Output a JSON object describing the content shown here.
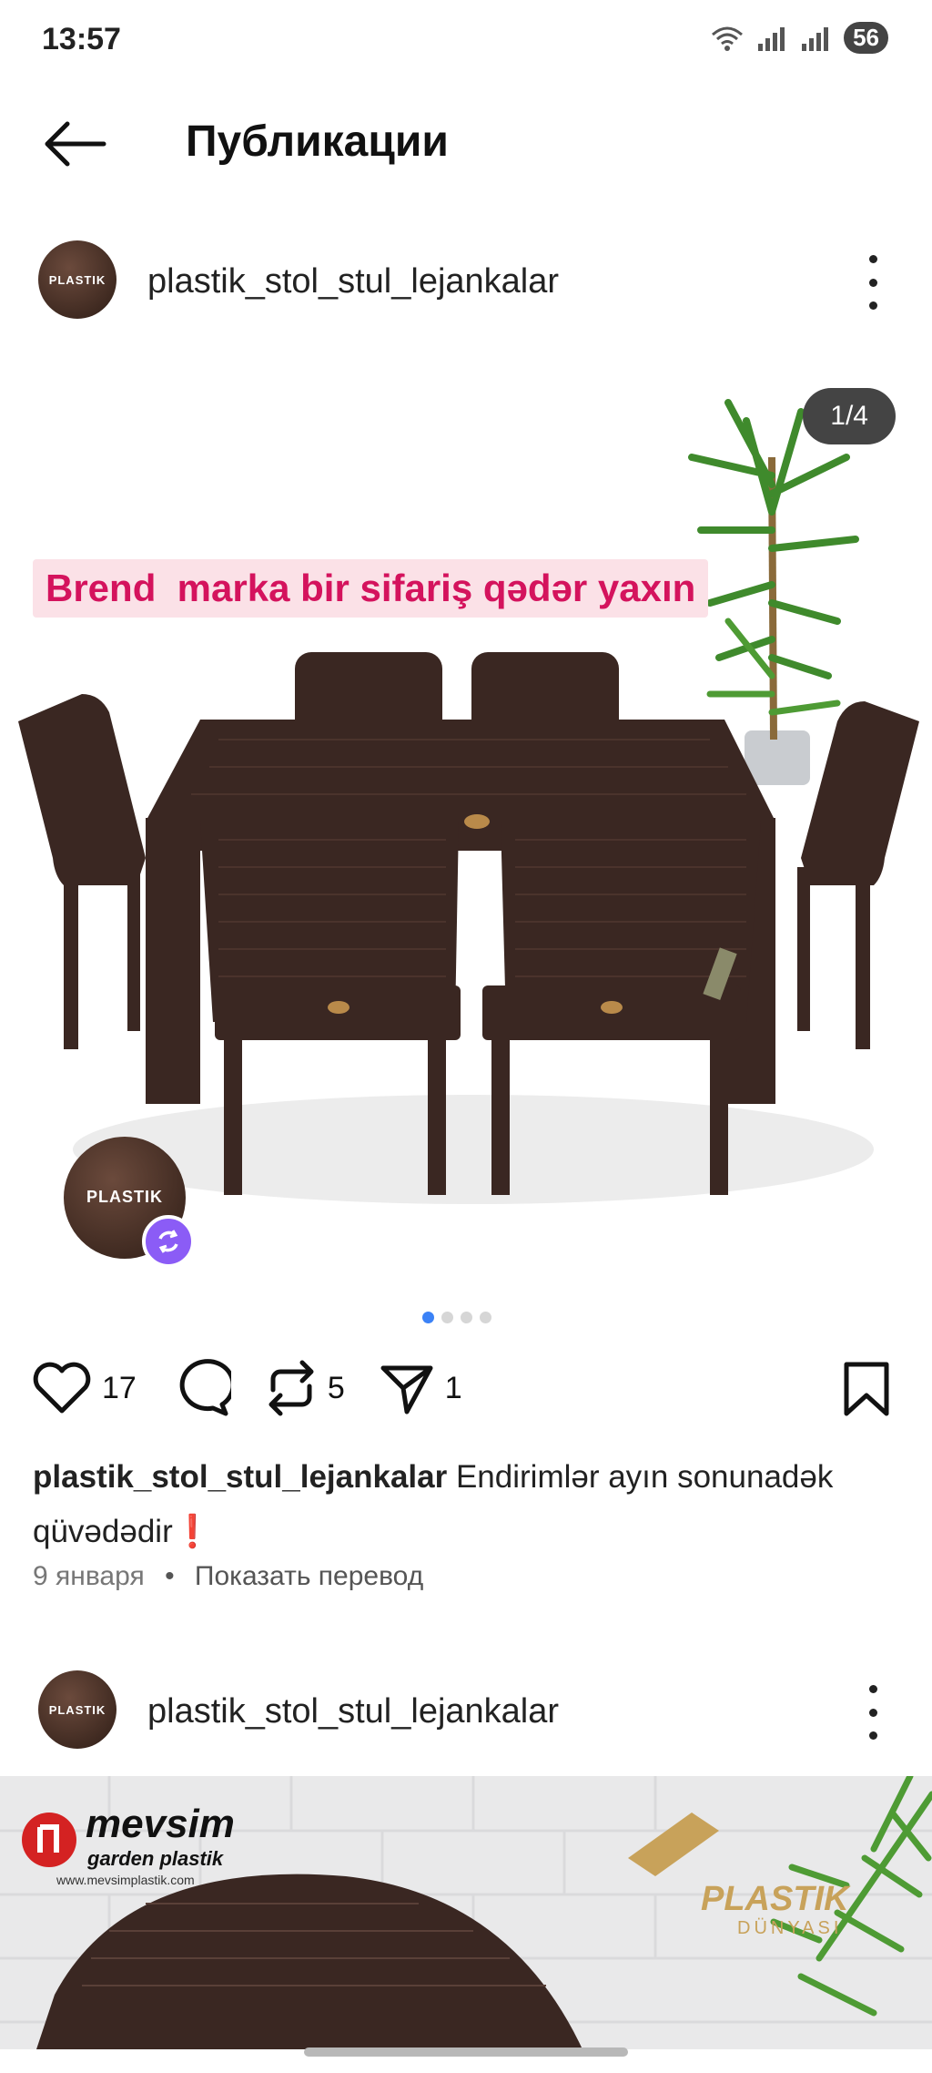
{
  "status_bar": {
    "time": "13:57",
    "battery": "56"
  },
  "header": {
    "title": "Публикации"
  },
  "post1": {
    "username": "plastik_stol_stul_lejankalar",
    "avatar_text": "PLASTIK",
    "media_counter": "1/4",
    "promo_text": "Brend  marka bir sifariş qədər yaxın",
    "slide_count": 4,
    "active_slide": 1,
    "likes": "17",
    "reposts": "5",
    "shares": "1",
    "caption_user": "plastik_stol_stul_lejankalar",
    "caption_text": " Endirimlər ayın sonunadək qüvədədir❗",
    "date": "9 января",
    "separator": "•",
    "translate_link": "Показать перевод"
  },
  "post2": {
    "username": "plastik_stol_stul_lejankalar",
    "avatar_text": "PLASTIK",
    "brand_name": "mevsim",
    "brand_sub": "garden plastik",
    "brand_url": "www.mevsimplastik.com",
    "logo_text": "PLASTIK",
    "logo_sub": "DÜNYASI"
  },
  "colors": {
    "accent_dot": "#3b82f6",
    "promo_text": "#d4135d",
    "furniture": "#3a2722"
  }
}
